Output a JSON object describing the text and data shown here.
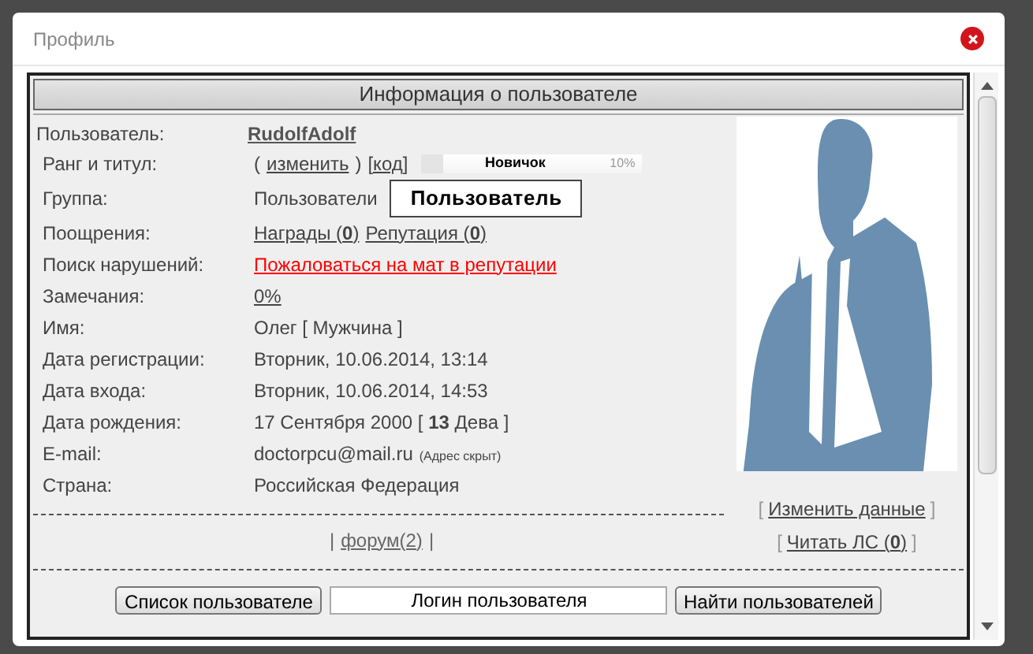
{
  "dialog": {
    "title": "Профиль"
  },
  "panel": {
    "heading": "Информация о пользователе"
  },
  "user": {
    "label": "Пользователь:",
    "name": "RudolfAdolf"
  },
  "rows": [
    {
      "label": "Ранг и титул:",
      "parts": [
        {
          "kind": "text",
          "text": "("
        },
        {
          "kind": "link",
          "text": "изменить"
        },
        {
          "kind": "text",
          "text": ")"
        },
        {
          "kind": "link",
          "text": "[код]"
        },
        {
          "kind": "rank",
          "text": "Новичок",
          "percent": "10%",
          "level": 0.1
        }
      ]
    },
    {
      "label": "Группа:",
      "parts": [
        {
          "kind": "text",
          "text": "Пользователи"
        },
        {
          "kind": "badge",
          "text": "Пользователь"
        }
      ]
    },
    {
      "label": "Поощрения:",
      "parts": [
        {
          "kind": "link",
          "text": "Награды (**0**)"
        },
        {
          "kind": "link",
          "text": "Репутация (**0**)"
        }
      ]
    },
    {
      "label": "Поиск нарушений:",
      "parts": [
        {
          "kind": "alert",
          "text": "Пожаловаться на мат в репутации"
        }
      ]
    },
    {
      "label": "Замечания:",
      "parts": [
        {
          "kind": "link",
          "text": "0%"
        }
      ]
    },
    {
      "label": "Имя:",
      "parts": [
        {
          "kind": "text",
          "text": "Олег [ Мужчина ]"
        }
      ]
    },
    {
      "label": "Дата регистрации:",
      "parts": [
        {
          "kind": "text",
          "text": "Вторник, 10.06.2014, 13:14"
        }
      ]
    },
    {
      "label": "Дата входа:",
      "parts": [
        {
          "kind": "text",
          "text": "Вторник, 10.06.2014, 14:53"
        }
      ]
    },
    {
      "label": "Дата рождения:",
      "parts": [
        {
          "kind": "text",
          "text": "17 Сентября 2000 [ **13** Дева ]"
        }
      ]
    },
    {
      "label": "E-mail:",
      "parts": [
        {
          "kind": "text",
          "text": "doctorpcu@mail.ru"
        },
        {
          "kind": "note",
          "text": "(Адрес скрыт)"
        }
      ]
    },
    {
      "label": "Страна:",
      "parts": [
        {
          "kind": "text",
          "text": "Российская Федерация"
        }
      ]
    }
  ],
  "side_links": [
    {
      "open": "[",
      "text": "Изменить данные",
      "close": "]"
    },
    {
      "open": "[",
      "text": "Читать ЛС (**0**)",
      "close": "]"
    }
  ],
  "forum": {
    "left": "|",
    "link": "форум(2)",
    "right": "|"
  },
  "footer": {
    "list_button": "Список пользователе",
    "search_value": "Логин пользователя",
    "find_button": "Найти пользователей"
  }
}
